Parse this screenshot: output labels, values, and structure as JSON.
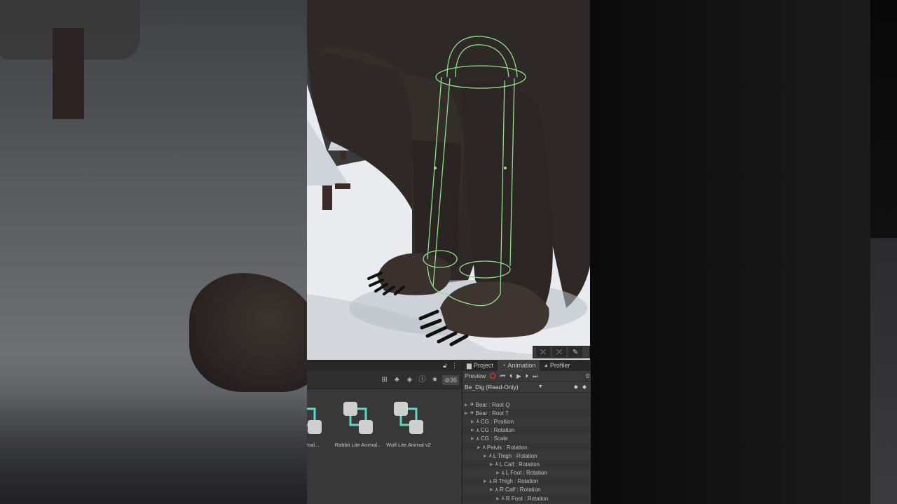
{
  "scene_toolbar": {
    "buttons": [
      "⤫",
      "⤫",
      "✎"
    ]
  },
  "project_panel": {
    "header_icons": [
      "lock-icon",
      "more-icon"
    ],
    "toolbar": {
      "hidden_count": "36"
    },
    "assets": [
      {
        "label": "s Animal..."
      },
      {
        "label": "Rabbit Lite Animal..."
      },
      {
        "label": "Wolf Lite Animal v2"
      }
    ]
  },
  "animation_panel": {
    "tabs": [
      {
        "label": "Project"
      },
      {
        "label": "Animation"
      },
      {
        "label": "Profiler"
      }
    ],
    "preview_label": "Preview",
    "frame": "0",
    "clip_name": "Be_Dig (Read-Only)",
    "properties": [
      {
        "label": "Bear : Root Q",
        "indent": 0
      },
      {
        "label": "Bear : Root T",
        "indent": 0
      },
      {
        "label": "CG : Position",
        "indent": 1
      },
      {
        "label": "CG : Rotation",
        "indent": 1
      },
      {
        "label": "CG : Scale",
        "indent": 1
      },
      {
        "label": "Pelvis : Rotation",
        "indent": 2
      },
      {
        "label": "L Thigh : Rotation",
        "indent": 3
      },
      {
        "label": "L Calf : Rotation",
        "indent": 4
      },
      {
        "label": "L Foot : Rotation",
        "indent": 5
      },
      {
        "label": "R Thigh : Rotation",
        "indent": 3
      },
      {
        "label": "R Calf : Rotation",
        "indent": 4
      },
      {
        "label": "R Foot : Rotation",
        "indent": 5
      }
    ]
  },
  "colors": {
    "gizmo": "#8fe08a",
    "bear": "#2e2826",
    "snow": "#e9ebee",
    "asset_icon": "#5ed8c4"
  }
}
